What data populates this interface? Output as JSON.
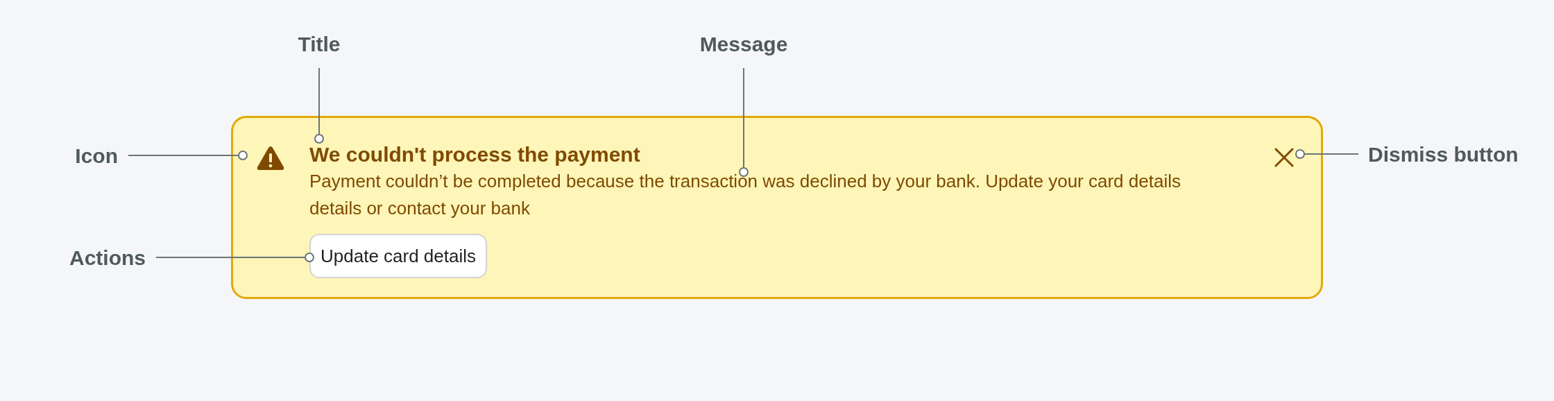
{
  "annotations": [
    {
      "label": "Title"
    },
    {
      "label": "Message"
    },
    {
      "label": "Icon"
    },
    {
      "label": "Dismiss button"
    },
    {
      "label": "Actions"
    }
  ],
  "alert": {
    "title": "We couldn't process the payment",
    "message": "Payment couldn’t be completed because the transaction was declined by your bank. Update your card details details or contact your bank",
    "action": "Update card details"
  }
}
